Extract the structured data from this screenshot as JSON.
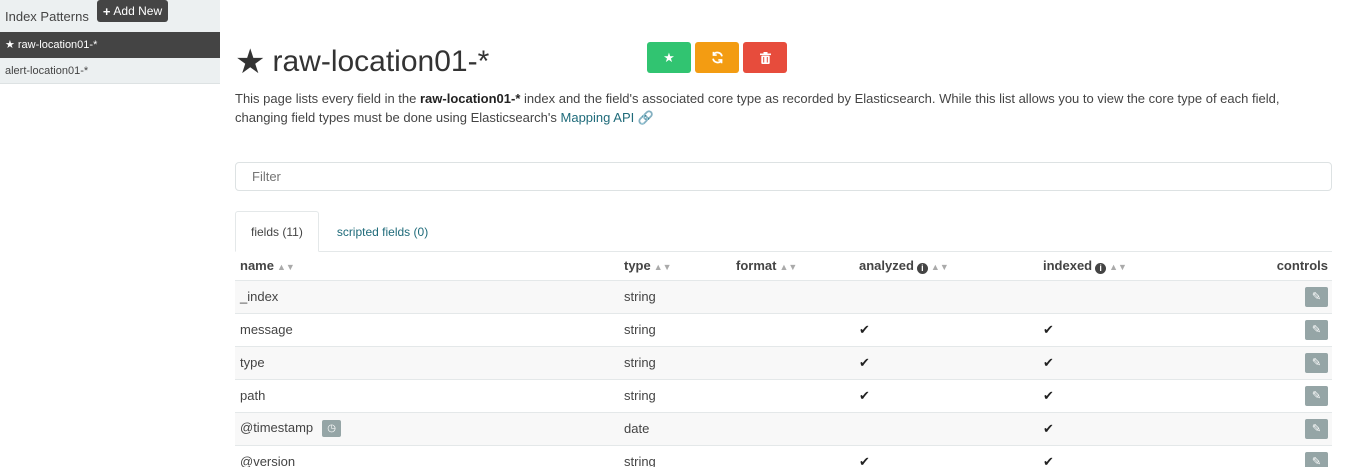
{
  "sidebar": {
    "title": "Index Patterns",
    "add_button": "Add New",
    "items": [
      {
        "label": "raw-location01-*",
        "active": true
      },
      {
        "label": "alert-location01-*",
        "active": false
      }
    ]
  },
  "header": {
    "title": "raw-location01-*",
    "buttons": [
      {
        "name": "set-default",
        "icon": "star-icon",
        "color": "#31c471"
      },
      {
        "name": "refresh-fields",
        "icon": "refresh-icon",
        "color": "#f39c12"
      },
      {
        "name": "delete-pattern",
        "icon": "trash-icon",
        "color": "#e74c3c"
      }
    ]
  },
  "description": {
    "part1": "This page lists every field in the ",
    "index_name": "raw-location01-*",
    "part2": " index and the field's associated core type as recorded by Elasticsearch. While this list allows you to view the core type of each field, changing field types must be done using Elasticsearch's ",
    "link": "Mapping API"
  },
  "filter": {
    "placeholder": "Filter"
  },
  "tabs": [
    {
      "label": "fields",
      "count": "(11)"
    },
    {
      "label": "scripted fields",
      "count": "(0)"
    }
  ],
  "table": {
    "columns": {
      "name": "name",
      "type": "type",
      "format": "format",
      "analyzed": "analyzed",
      "indexed": "indexed",
      "controls": "controls"
    },
    "rows": [
      {
        "name": "_index",
        "type": "string",
        "format": "",
        "analyzed": false,
        "indexed": false
      },
      {
        "name": "message",
        "type": "string",
        "format": "",
        "analyzed": true,
        "indexed": true
      },
      {
        "name": "type",
        "type": "string",
        "format": "",
        "analyzed": true,
        "indexed": true
      },
      {
        "name": "path",
        "type": "string",
        "format": "",
        "analyzed": true,
        "indexed": true
      },
      {
        "name": "@timestamp",
        "type": "date",
        "format": "",
        "analyzed": false,
        "indexed": true,
        "time_field": true
      },
      {
        "name": "@version",
        "type": "string",
        "format": "",
        "analyzed": true,
        "indexed": true
      }
    ]
  }
}
